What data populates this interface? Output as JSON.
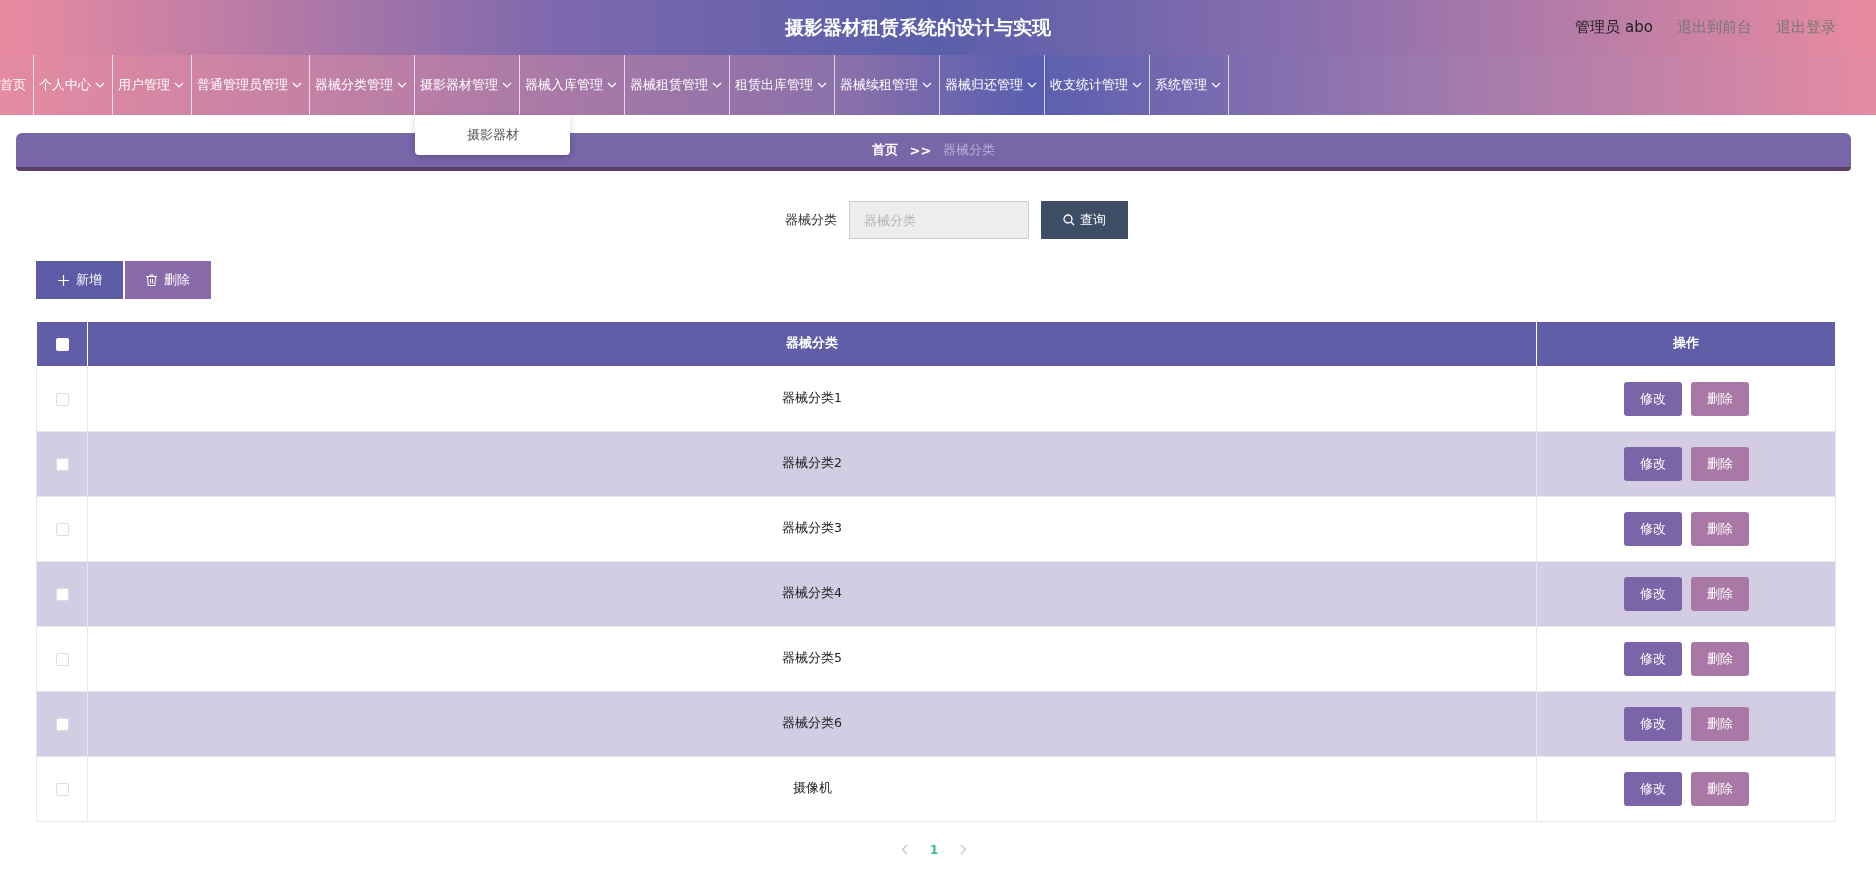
{
  "header": {
    "title": "摄影器材租赁系统的设计与实现",
    "user": "管理员 abo",
    "links": [
      "退出到前台",
      "退出登录"
    ]
  },
  "nav": {
    "items": [
      {
        "label": "首页",
        "has_menu": false
      },
      {
        "label": "个人中心",
        "has_menu": true
      },
      {
        "label": "用户管理",
        "has_menu": true
      },
      {
        "label": "普通管理员管理",
        "has_menu": true
      },
      {
        "label": "器械分类管理",
        "has_menu": true
      },
      {
        "label": "摄影器材管理",
        "has_menu": true,
        "expanded": true,
        "children": [
          "摄影器材"
        ]
      },
      {
        "label": "器械入库管理",
        "has_menu": true
      },
      {
        "label": "器械租赁管理",
        "has_menu": true
      },
      {
        "label": "租赁出库管理",
        "has_menu": true
      },
      {
        "label": "器械续租管理",
        "has_menu": true
      },
      {
        "label": "器械归还管理",
        "has_menu": true
      },
      {
        "label": "收支统计管理",
        "has_menu": true
      },
      {
        "label": "系统管理",
        "has_menu": true
      }
    ]
  },
  "breadcrumb": {
    "home": "首页",
    "separator": ">>",
    "current": "器械分类"
  },
  "search": {
    "label": "器械分类",
    "placeholder": "器械分类",
    "button": "查询"
  },
  "actions": [
    {
      "label": "新增",
      "kind": "add"
    },
    {
      "label": "删除",
      "kind": "delete"
    }
  ],
  "table": {
    "select_all": {
      "checked": false
    },
    "columns": [
      "器械分类",
      "操作"
    ],
    "rows": [
      {
        "name": "器械分类1",
        "checked": false,
        "buttons": [
          "修改",
          "删除"
        ]
      },
      {
        "name": "器械分类2",
        "checked": false,
        "buttons": [
          "修改",
          "删除"
        ]
      },
      {
        "name": "器械分类3",
        "checked": false,
        "buttons": [
          "修改",
          "删除"
        ]
      },
      {
        "name": "器械分类4",
        "checked": false,
        "buttons": [
          "修改",
          "删除"
        ]
      },
      {
        "name": "器械分类5",
        "checked": false,
        "buttons": [
          "修改",
          "删除"
        ]
      },
      {
        "name": "器械分类6",
        "checked": false,
        "buttons": [
          "修改",
          "删除"
        ]
      },
      {
        "name": "摄像机",
        "checked": false,
        "buttons": [
          "修改",
          "删除"
        ]
      }
    ]
  },
  "pagination": {
    "pages": [
      {
        "label": "1",
        "selected": true
      }
    ]
  }
}
